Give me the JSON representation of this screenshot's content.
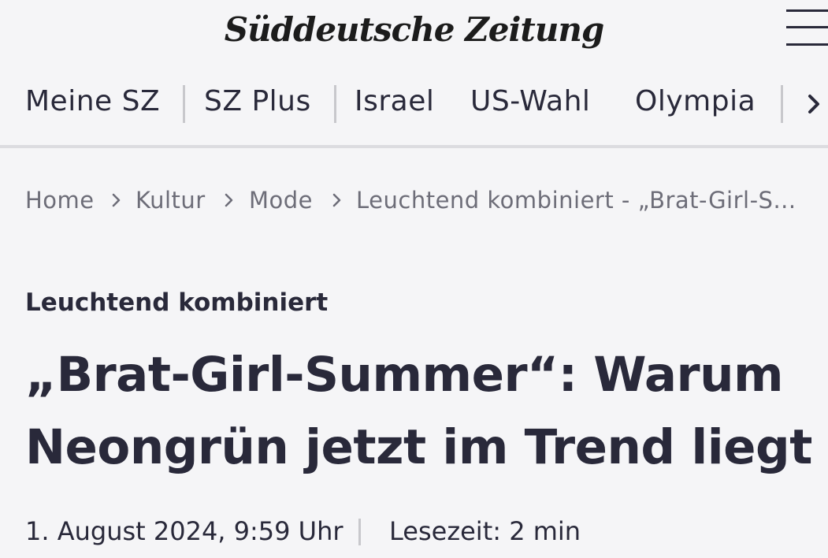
{
  "header": {
    "logo_text": "Süddeutsche Zeitung",
    "menu_icon": "hamburger-menu-icon"
  },
  "nav": {
    "items": [
      {
        "label": "Meine SZ"
      },
      {
        "label": "SZ Plus"
      },
      {
        "label": "Israel"
      },
      {
        "label": "US-Wahl"
      },
      {
        "label": "Olympia"
      }
    ],
    "more_icon": "chevron-right-icon"
  },
  "breadcrumb": {
    "items": [
      {
        "label": "Home"
      },
      {
        "label": "Kultur"
      },
      {
        "label": "Mode"
      },
      {
        "label": "Leuchtend kombiniert - „Brat-Girl-S..."
      }
    ],
    "separator_icon": "chevron-right-icon"
  },
  "article": {
    "kicker": "Leuchtend kombiniert",
    "headline": "„Brat-Girl-Summer“: Warum Neongrün jetzt im Trend liegt",
    "date": "1. August 2024, 9:59 Uhr",
    "reading_time": "Lesezeit: 2 min"
  },
  "colors": {
    "background": "#f5f5f7",
    "text": "#29293a",
    "muted_text": "#6d6d78",
    "separator": "#c8c8cc"
  }
}
